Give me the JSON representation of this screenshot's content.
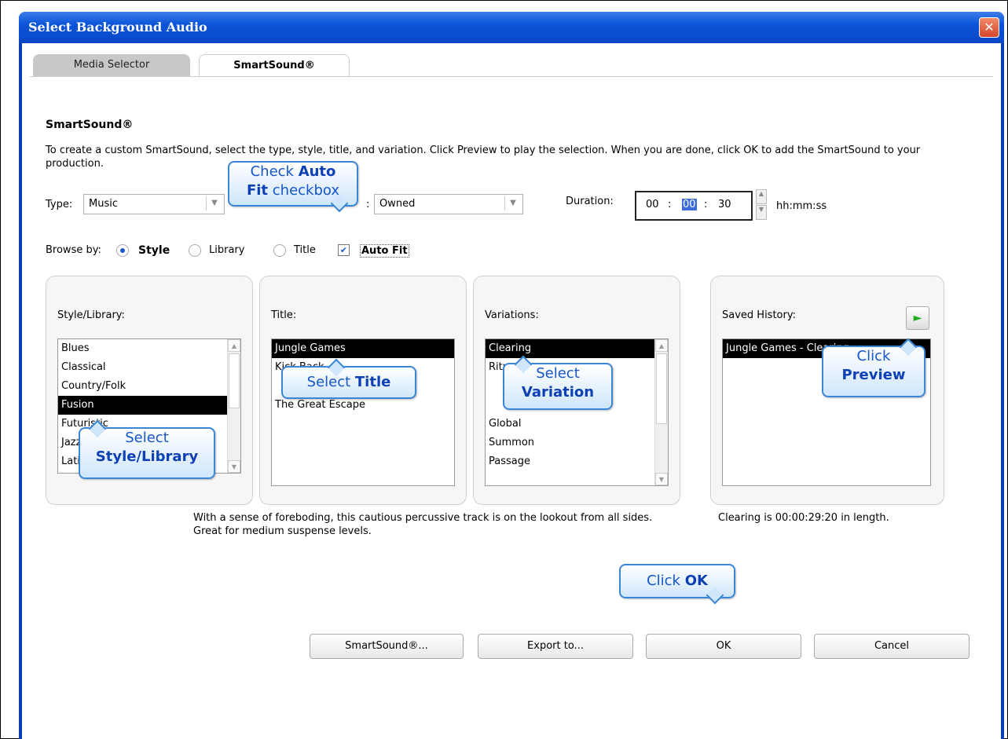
{
  "window": {
    "title": "Select Background Audio",
    "close_glyph": "✕"
  },
  "tabs": [
    {
      "label": "Media Selector"
    },
    {
      "label": "SmartSound®"
    }
  ],
  "heading": "SmartSound®",
  "description": "To create a custom SmartSound, select the type, style, title, and variation. Click Preview to play the selection. When you are done, click OK to add the SmartSound to your production.",
  "type": {
    "label": "Type:",
    "value": "Music"
  },
  "filter": {
    "label_fragment": ":",
    "value": "Owned"
  },
  "duration": {
    "label": "Duration:",
    "hh": "00",
    "mm": "00",
    "ss": "30",
    "sep": ":",
    "format": "hh:mm:ss"
  },
  "browse": {
    "label": "Browse by:",
    "options": [
      {
        "label": "Style",
        "selected": true
      },
      {
        "label": "Library",
        "selected": false
      },
      {
        "label": "Title",
        "selected": false
      }
    ],
    "auto_fit": {
      "label": "Auto Fit",
      "checked": true
    }
  },
  "panels": {
    "style_library": {
      "label": "Style/Library:",
      "items": [
        "Blues",
        "Classical",
        "Country/Folk",
        "Fusion",
        "Futuristic",
        "Jazz",
        "Latin"
      ],
      "selected": "Fusion"
    },
    "title": {
      "label": "Title:",
      "items": [
        "Jungle Games",
        "Kick Back",
        "",
        "The Great Escape"
      ],
      "selected": "Jungle Games"
    },
    "variations": {
      "label": "Variations:",
      "items": [
        "Clearing",
        "Ritual",
        "",
        "",
        "Global",
        "Summon",
        "Passage"
      ],
      "selected": "Clearing"
    },
    "saved_history": {
      "label": "Saved History:",
      "items": [
        "Jungle Games - Clearing"
      ],
      "selected": "Jungle Games - Clearing"
    }
  },
  "track_description": "With a sense of foreboding, this cautious percussive track is on the lookout from all sides. Great for medium suspense levels.",
  "length_info": "Clearing is 00:00:29:20 in length.",
  "buttons": {
    "smartsound": "SmartSound®...",
    "export": "Export to...",
    "ok": "OK",
    "cancel": "Cancel"
  },
  "callouts": {
    "auto_fit": {
      "line1_a": "Check ",
      "line1_b": "Auto",
      "line2_a": "Fit",
      "line2_b": " checkbox"
    },
    "title": {
      "a": "Select ",
      "b": "Title"
    },
    "variation": {
      "a": "Select",
      "b": "Variation"
    },
    "style": {
      "a": "Select",
      "b": "Style/Library"
    },
    "preview": {
      "a": "Click",
      "b": "Preview"
    },
    "ok": {
      "a": "Click ",
      "b": "OK"
    }
  },
  "colors": {
    "titlebar": "#0b54d9",
    "selection": "#000000",
    "callout_border": "#3a86d6",
    "callout_text": "#1455c8",
    "preview_arrow": "#1cae1c"
  },
  "icons": {
    "preview": "play-icon",
    "close": "close-icon",
    "combo_arrow": "chevron-down-icon"
  }
}
